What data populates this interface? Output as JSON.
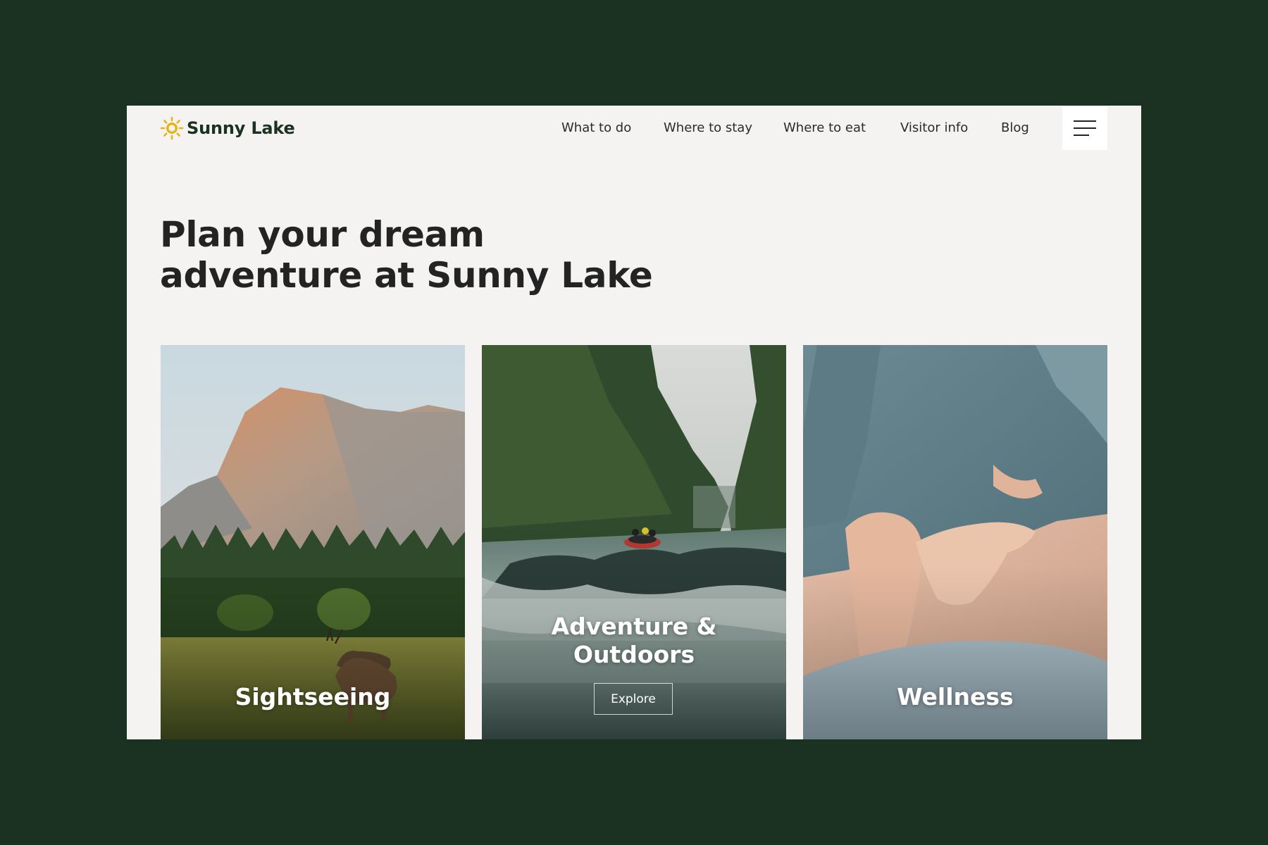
{
  "brand": {
    "name": "Sunny Lake",
    "logo_icon": "sun-icon",
    "logo_color": "#e6b415",
    "text_color": "#1b3223"
  },
  "nav": {
    "items": [
      {
        "label": "What to do"
      },
      {
        "label": "Where to stay"
      },
      {
        "label": "Where to eat"
      },
      {
        "label": "Visitor info"
      },
      {
        "label": "Blog"
      }
    ],
    "menu_icon": "hamburger-menu-icon"
  },
  "hero": {
    "heading_line1": "Plan your dream",
    "heading_line2": "adventure at Sunny Lake"
  },
  "cards": [
    {
      "title": "Sightseeing",
      "image": "mountain-meadow-deer-photo"
    },
    {
      "title_line1": "Adventure &",
      "title_line2": "Outdoors",
      "button_label": "Explore",
      "image": "river-rafting-photo"
    },
    {
      "title": "Wellness",
      "image": "massage-photo"
    }
  ],
  "colors": {
    "page_background": "#1b3223",
    "frame_background": "#f4f3f1",
    "heading": "#232323"
  }
}
